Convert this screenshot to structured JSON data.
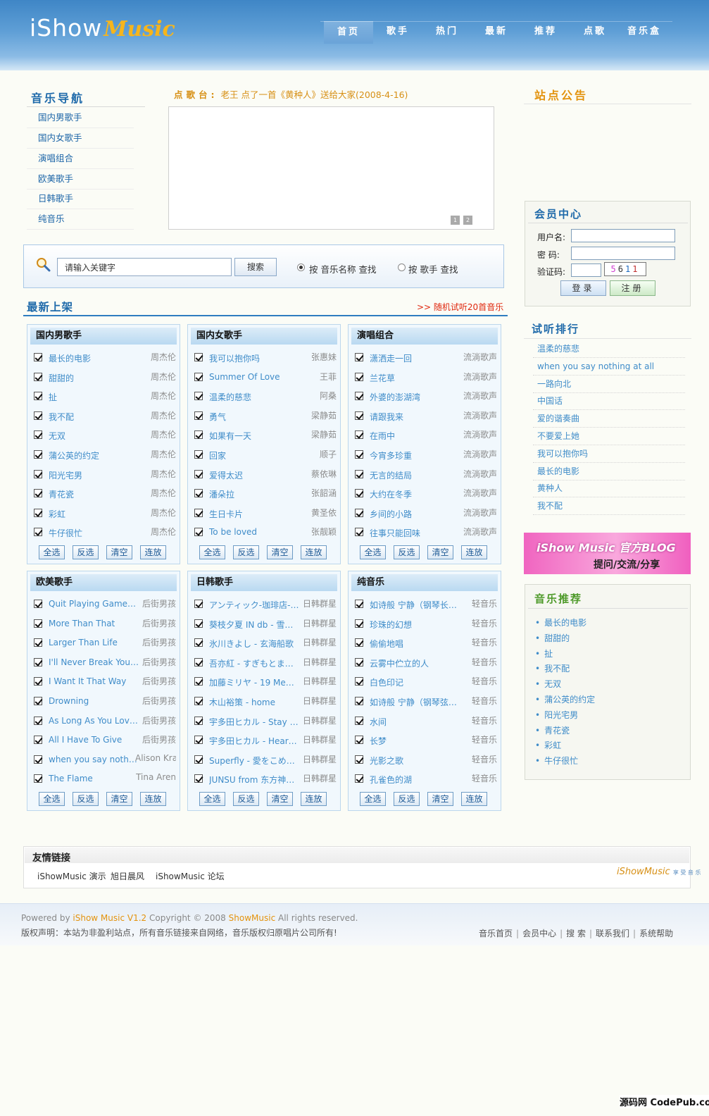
{
  "header": {
    "logo_text": "iShow",
    "logo_script": "Music",
    "nav": [
      "首页",
      "歌手",
      "热门",
      "最新",
      "推荐",
      "点歌",
      "音乐盒"
    ]
  },
  "music_nav": {
    "title": "音乐导航",
    "items": [
      "国内男歌手",
      "国内女歌手",
      "演唱组合",
      "欧美歌手",
      "日韩歌手",
      "纯音乐"
    ]
  },
  "request": {
    "label": "点歌台:",
    "user": "老王",
    "text": "点了一首《黄种人》送给大家(2008-4-16)",
    "pages": [
      "1",
      "2"
    ]
  },
  "search": {
    "value": "请输入关键字",
    "button": "搜索",
    "option1": "按 音乐名称 查找",
    "option2": "按 歌手 查找"
  },
  "new_arrivals": {
    "title": "最新上架",
    "random_link": ">> 随机试听20首音乐",
    "buttons": [
      "全选",
      "反选",
      "清空",
      "连放"
    ],
    "panels": [
      {
        "title": "国内男歌手",
        "rows": [
          {
            "song": "最长的电影",
            "artist": "周杰伦"
          },
          {
            "song": "甜甜的",
            "artist": "周杰伦"
          },
          {
            "song": "扯",
            "artist": "周杰伦"
          },
          {
            "song": "我不配",
            "artist": "周杰伦"
          },
          {
            "song": "无双",
            "artist": "周杰伦"
          },
          {
            "song": "蒲公英的约定",
            "artist": "周杰伦"
          },
          {
            "song": "阳光宅男",
            "artist": "周杰伦"
          },
          {
            "song": "青花瓷",
            "artist": "周杰伦"
          },
          {
            "song": "彩虹",
            "artist": "周杰伦"
          },
          {
            "song": "牛仔很忙",
            "artist": "周杰伦"
          }
        ]
      },
      {
        "title": "国内女歌手",
        "rows": [
          {
            "song": "我可以抱你吗",
            "artist": "张惠妹"
          },
          {
            "song": "Summer Of Love",
            "artist": "王菲"
          },
          {
            "song": "温柔的慈悲",
            "artist": "阿桑"
          },
          {
            "song": "勇气",
            "artist": "梁静茹"
          },
          {
            "song": "如果有一天",
            "artist": "梁静茹"
          },
          {
            "song": "回家",
            "artist": "顺子"
          },
          {
            "song": "爱得太迟",
            "artist": "蔡依琳"
          },
          {
            "song": "潘朵拉",
            "artist": "张韶涵"
          },
          {
            "song": "生日卡片",
            "artist": "黄圣依"
          },
          {
            "song": "To be loved",
            "artist": "张靓颖"
          }
        ]
      },
      {
        "title": "演唱组合",
        "rows": [
          {
            "song": "潇洒走一回",
            "artist": "流淌歌声"
          },
          {
            "song": "兰花草",
            "artist": "流淌歌声"
          },
          {
            "song": "外婆的澎湖湾",
            "artist": "流淌歌声"
          },
          {
            "song": "请跟我来",
            "artist": "流淌歌声"
          },
          {
            "song": "在雨中",
            "artist": "流淌歌声"
          },
          {
            "song": "今宵多珍重",
            "artist": "流淌歌声"
          },
          {
            "song": "无言的结局",
            "artist": "流淌歌声"
          },
          {
            "song": "大约在冬季",
            "artist": "流淌歌声"
          },
          {
            "song": "乡间的小路",
            "artist": "流淌歌声"
          },
          {
            "song": "往事只能回味",
            "artist": "流淌歌声"
          }
        ]
      },
      {
        "title": "欧美歌手",
        "rows": [
          {
            "song": "Quit Playing Games (…",
            "artist": "后街男孩"
          },
          {
            "song": "More Than That",
            "artist": "后街男孩"
          },
          {
            "song": "Larger Than Life",
            "artist": "后街男孩"
          },
          {
            "song": "I'll Never Break Your …",
            "artist": "后街男孩"
          },
          {
            "song": "I Want It That Way",
            "artist": "后街男孩"
          },
          {
            "song": "Drowning",
            "artist": "后街男孩"
          },
          {
            "song": "As Long As You Love…",
            "artist": "后街男孩"
          },
          {
            "song": "All I Have To Give",
            "artist": "后街男孩"
          },
          {
            "song": "when you say nothin…",
            "artist": "Alison Kra"
          },
          {
            "song": "The Flame",
            "artist": "Tina Aren"
          }
        ]
      },
      {
        "title": "日韩歌手",
        "rows": [
          {
            "song": "アンティック-珈琲店- - …",
            "artist": "日韩群星"
          },
          {
            "song": "葵枝夕夏 IN db - 雪…",
            "artist": "日韩群星"
          },
          {
            "song": "氷川きよし - 玄海船歌",
            "artist": "日韩群星"
          },
          {
            "song": "吾亦紅 - すぎもとまさと",
            "artist": "日韩群星"
          },
          {
            "song": "加藤ミリヤ - 19 Memo…",
            "artist": "日韩群星"
          },
          {
            "song": "木山裕策 - home",
            "artist": "日韩群星"
          },
          {
            "song": "宇多田ヒカル - Stay G…",
            "artist": "日韩群星"
          },
          {
            "song": "宇多田ヒカル - Heart …",
            "artist": "日韩群星"
          },
          {
            "song": "Superfly - 愛をこめて…",
            "artist": "日韩群星"
          },
          {
            "song": "JUNSU from 东方神起…",
            "artist": "日韩群星"
          }
        ]
      },
      {
        "title": "纯音乐",
        "rows": [
          {
            "song": "如诗般 宁静（钢琴长…",
            "artist": "轻音乐"
          },
          {
            "song": "珍珠的幻想",
            "artist": "轻音乐"
          },
          {
            "song": "偷偷地唱",
            "artist": "轻音乐"
          },
          {
            "song": "云雾中伫立的人",
            "artist": "轻音乐"
          },
          {
            "song": "白色印记",
            "artist": "轻音乐"
          },
          {
            "song": "如诗般 宁静（钢琴弦…",
            "artist": "轻音乐"
          },
          {
            "song": "水间",
            "artist": "轻音乐"
          },
          {
            "song": "长梦",
            "artist": "轻音乐"
          },
          {
            "song": "光影之歌",
            "artist": "轻音乐"
          },
          {
            "song": "孔雀色的湖",
            "artist": "轻音乐"
          }
        ]
      }
    ]
  },
  "notice": {
    "title": "站点公告"
  },
  "member": {
    "title": "会员中心",
    "username_label": "用户名:",
    "password_label": "密  码:",
    "captcha_label": "验证码:",
    "captcha": [
      "5",
      "6",
      "1",
      "1"
    ],
    "login": "登录",
    "register": "注册"
  },
  "ranking": {
    "title": "试听排行",
    "items": [
      "温柔的慈悲",
      "when you say nothing at all",
      "一路向北",
      "中国话",
      "爱的谐奏曲",
      "不要爱上她",
      "我可以抱你吗",
      "最长的电影",
      "黄种人",
      "我不配"
    ]
  },
  "banner": {
    "line1": "iShow Music 官方BLOG",
    "line2": "提问/交流/分享"
  },
  "recommend": {
    "title": "音乐推荐",
    "items": [
      "最长的电影",
      "甜甜的",
      "扯",
      "我不配",
      "无双",
      "蒲公英的约定",
      "阳光宅男",
      "青花瓷",
      "彩虹",
      "牛仔很忙"
    ]
  },
  "friend_links": {
    "title": "友情链接",
    "items": [
      "iShowMusic 演示",
      "旭日晨风",
      "iShowMusic 论坛"
    ],
    "logo": "iShowMusic",
    "logo_sub": "享 受 音 乐"
  },
  "footer": {
    "powered_prefix": "Powered by",
    "product": "iShow Music V1.2",
    "copyright": "Copyright © 2008",
    "brand": "ShowMusic",
    "rights": "All rights reserved.",
    "disclaimer": "版权声明：本站为非盈利站点，所有音乐链接来自网络，音乐版权归原唱片公司所有!",
    "nav": [
      "音乐首页",
      "会员中心",
      "搜 索",
      "联系我们",
      "系统帮助"
    ]
  },
  "watermark": "源码网 CodePub.com"
}
